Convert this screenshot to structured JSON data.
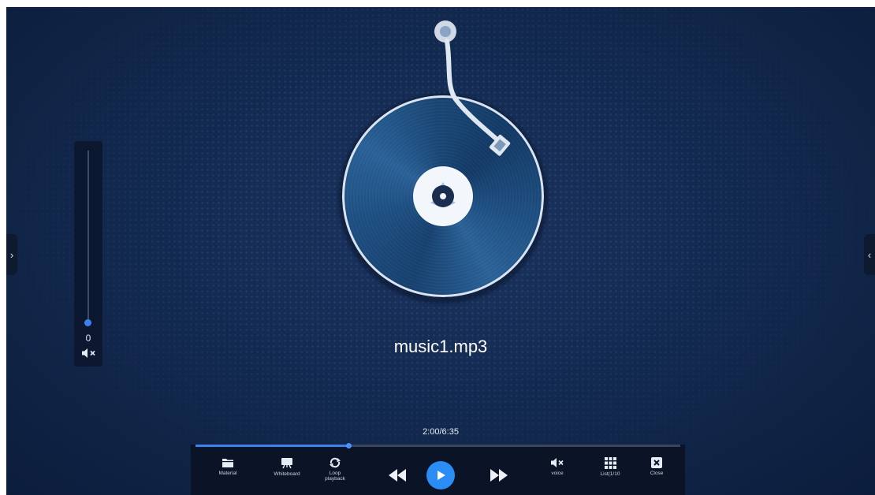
{
  "track": {
    "title": "music1.mp3",
    "time": "2:00/6:35",
    "progress_fraction": 0.316
  },
  "volume": {
    "value": "0",
    "level_fraction": 0.0,
    "muted": true
  },
  "controls": {
    "material_label": "Material",
    "whiteboard_label": "Whiteboard",
    "loop_label_line1": "Loop",
    "loop_label_line2": "playback",
    "voice_label": "voice",
    "list_label": "List(1/10",
    "close_label": "Close"
  },
  "icons": {
    "left_handle": "chevron-right-icon",
    "right_handle": "chevron-left-icon",
    "material": "folder-icon",
    "whiteboard": "easel-icon",
    "loop": "loop-icon",
    "rewind": "rewind-icon",
    "play": "play-icon",
    "forward": "fast-forward-icon",
    "voice": "speaker-mute-icon",
    "list": "grid-icon",
    "close": "close-icon"
  },
  "colors": {
    "accent": "#2a8cf5",
    "background": "#132a50",
    "control_bar": "#0a1426"
  }
}
